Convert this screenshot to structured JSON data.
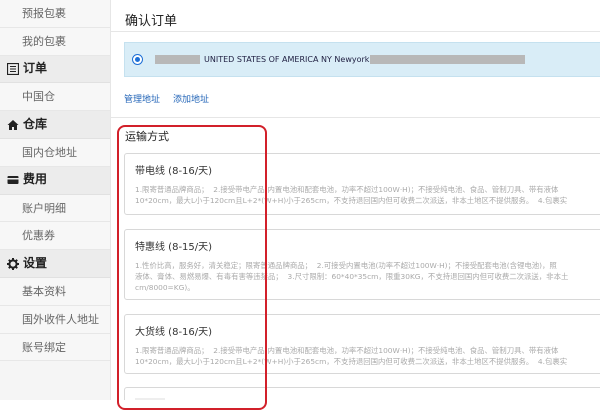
{
  "sidebar": {
    "items": [
      {
        "type": "item",
        "label": "预报包裹",
        "name": "sidebar-item-forecast-package"
      },
      {
        "type": "item",
        "label": "我的包裹",
        "name": "sidebar-item-my-package"
      },
      {
        "type": "head",
        "label": "订单",
        "icon": "list-icon",
        "name": "sidebar-head-order"
      },
      {
        "type": "item",
        "label": "中国仓",
        "name": "sidebar-item-china-warehouse"
      },
      {
        "type": "head",
        "label": "仓库",
        "icon": "home-icon",
        "name": "sidebar-head-warehouse"
      },
      {
        "type": "item",
        "label": "国内仓地址",
        "name": "sidebar-item-domestic-address"
      },
      {
        "type": "head",
        "label": "费用",
        "icon": "card-icon",
        "name": "sidebar-head-fees"
      },
      {
        "type": "item",
        "label": "账户明细",
        "name": "sidebar-item-account-details"
      },
      {
        "type": "item",
        "label": "优惠券",
        "name": "sidebar-item-coupons"
      },
      {
        "type": "head",
        "label": "设置",
        "icon": "gear-icon",
        "name": "sidebar-head-settings"
      },
      {
        "type": "item",
        "label": "基本资料",
        "name": "sidebar-item-profile"
      },
      {
        "type": "item",
        "label": "国外收件人地址",
        "name": "sidebar-item-overseas-recipient"
      },
      {
        "type": "item",
        "label": "账号绑定",
        "name": "sidebar-item-account-binding"
      }
    ]
  },
  "main": {
    "title": "确认订单",
    "address": {
      "text": "UNITED STATES OF AMERICA NY Newyork"
    },
    "links": {
      "manage": "管理地址",
      "add": "添加地址"
    },
    "shipping": {
      "title": "运输方式",
      "options": [
        {
          "title": "带电线 (8-16/天)",
          "desc1": "1.限寄普通品牌商品；  2.接受带电产品(内置电池和配套电池，功率不超过100W·H)；不接受纯电池、食品、管制刀具、带有液体",
          "desc2": "10*20cm，最大L小于120cm且L+2*(W+H)小于265cm，不支持退回国内但可收费二次派送，非本土地区不提供服务。  4.包裹实"
        },
        {
          "title": "特惠线 (8-15/天)",
          "desc1": "1.性价比高，服务好，清关稳定；限寄普通品牌商品；  2.可接受内置电池(功率不超过100W·H)；不接受配套电池(含锂电池)，照",
          "desc2": "液体、膏体、易燃易爆、有毒有害等违禁品；  3.尺寸限制：60*40*35cm，限重30KG，不支持退回国内但可收费二次派送，非本土",
          "desc3": "cm/8000=KG)。"
        },
        {
          "title": "大货线 (8-16/天)",
          "desc1": "1.限寄普通品牌商品；  2.接受带电产品(内置电池和配套电池，功率不超过100W·H)；不接受纯电池、食品、管制刀具、带有液体",
          "desc2": "10*20cm，最大L小于120cm且L+2*(W+H)小于265cm，不支持退回国内但可收费二次派送，非本土地区不提供服务。  4.包裹实"
        }
      ]
    }
  },
  "colors": {
    "accent": "#2466b8",
    "highlight": "#d2202a",
    "address_bg": "#d9edf7"
  }
}
